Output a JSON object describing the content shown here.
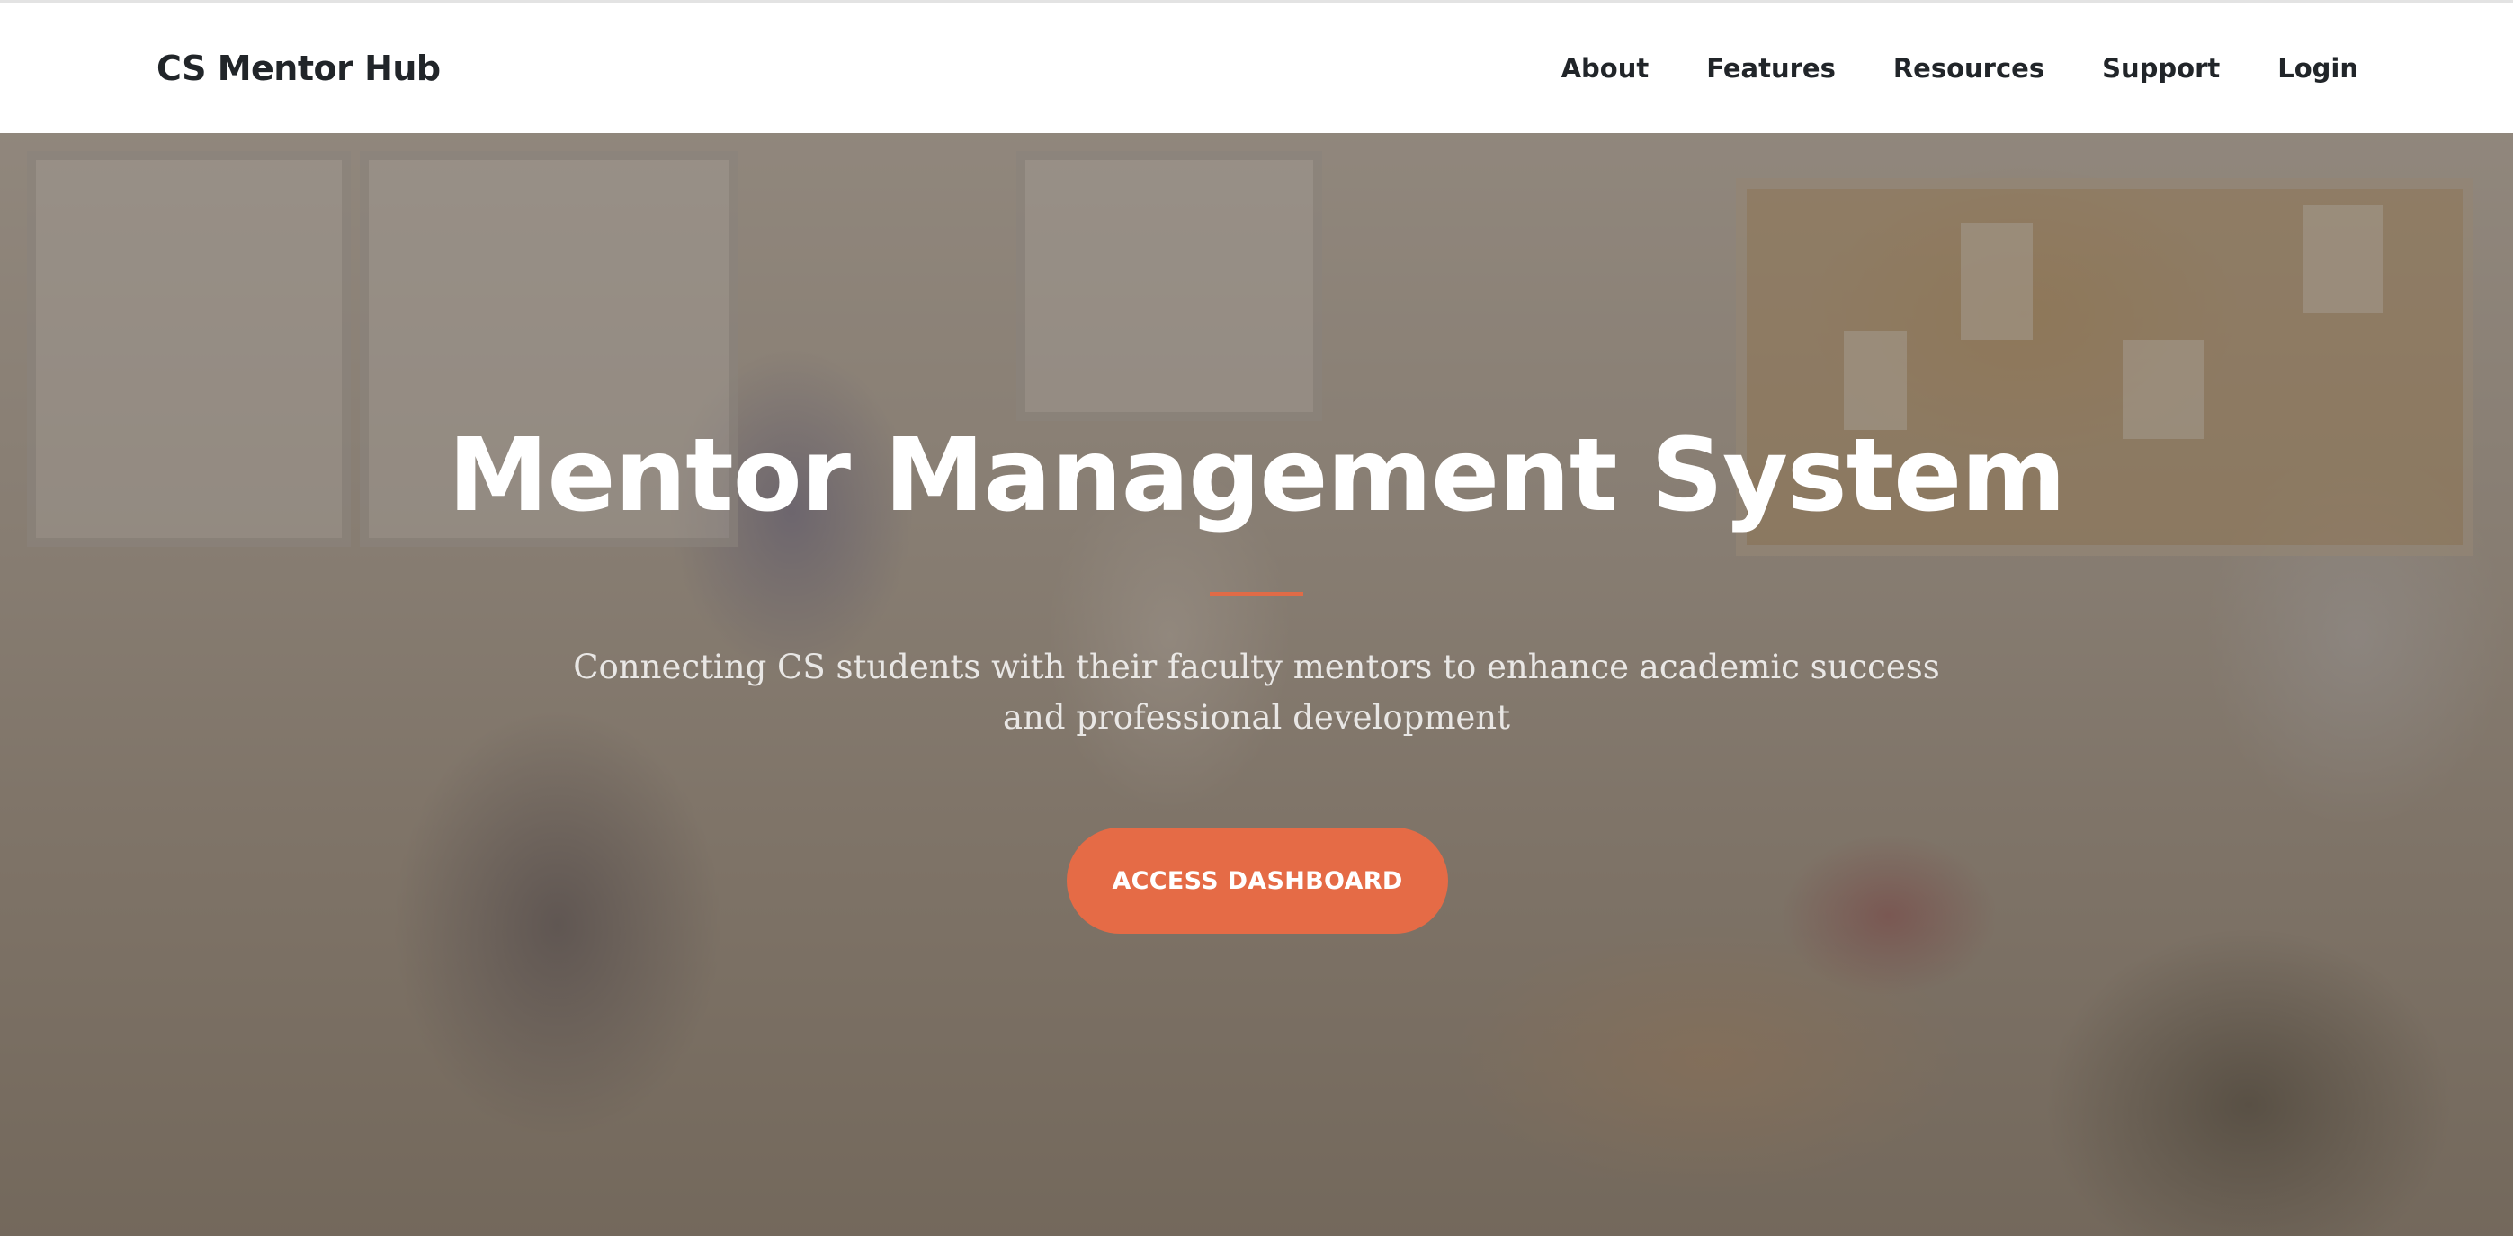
{
  "navbar": {
    "brand": "CS Mentor Hub",
    "links": [
      "About",
      "Features",
      "Resources",
      "Support",
      "Login"
    ]
  },
  "hero": {
    "title": "Mentor Management System",
    "subtitle": "Connecting CS students with their faculty mentors to enhance academic success and professional development",
    "cta_label": "ACCESS DASHBOARD",
    "accent_color": "#e56b46",
    "background": "classroom photo with mentor and students, dark overlay"
  }
}
